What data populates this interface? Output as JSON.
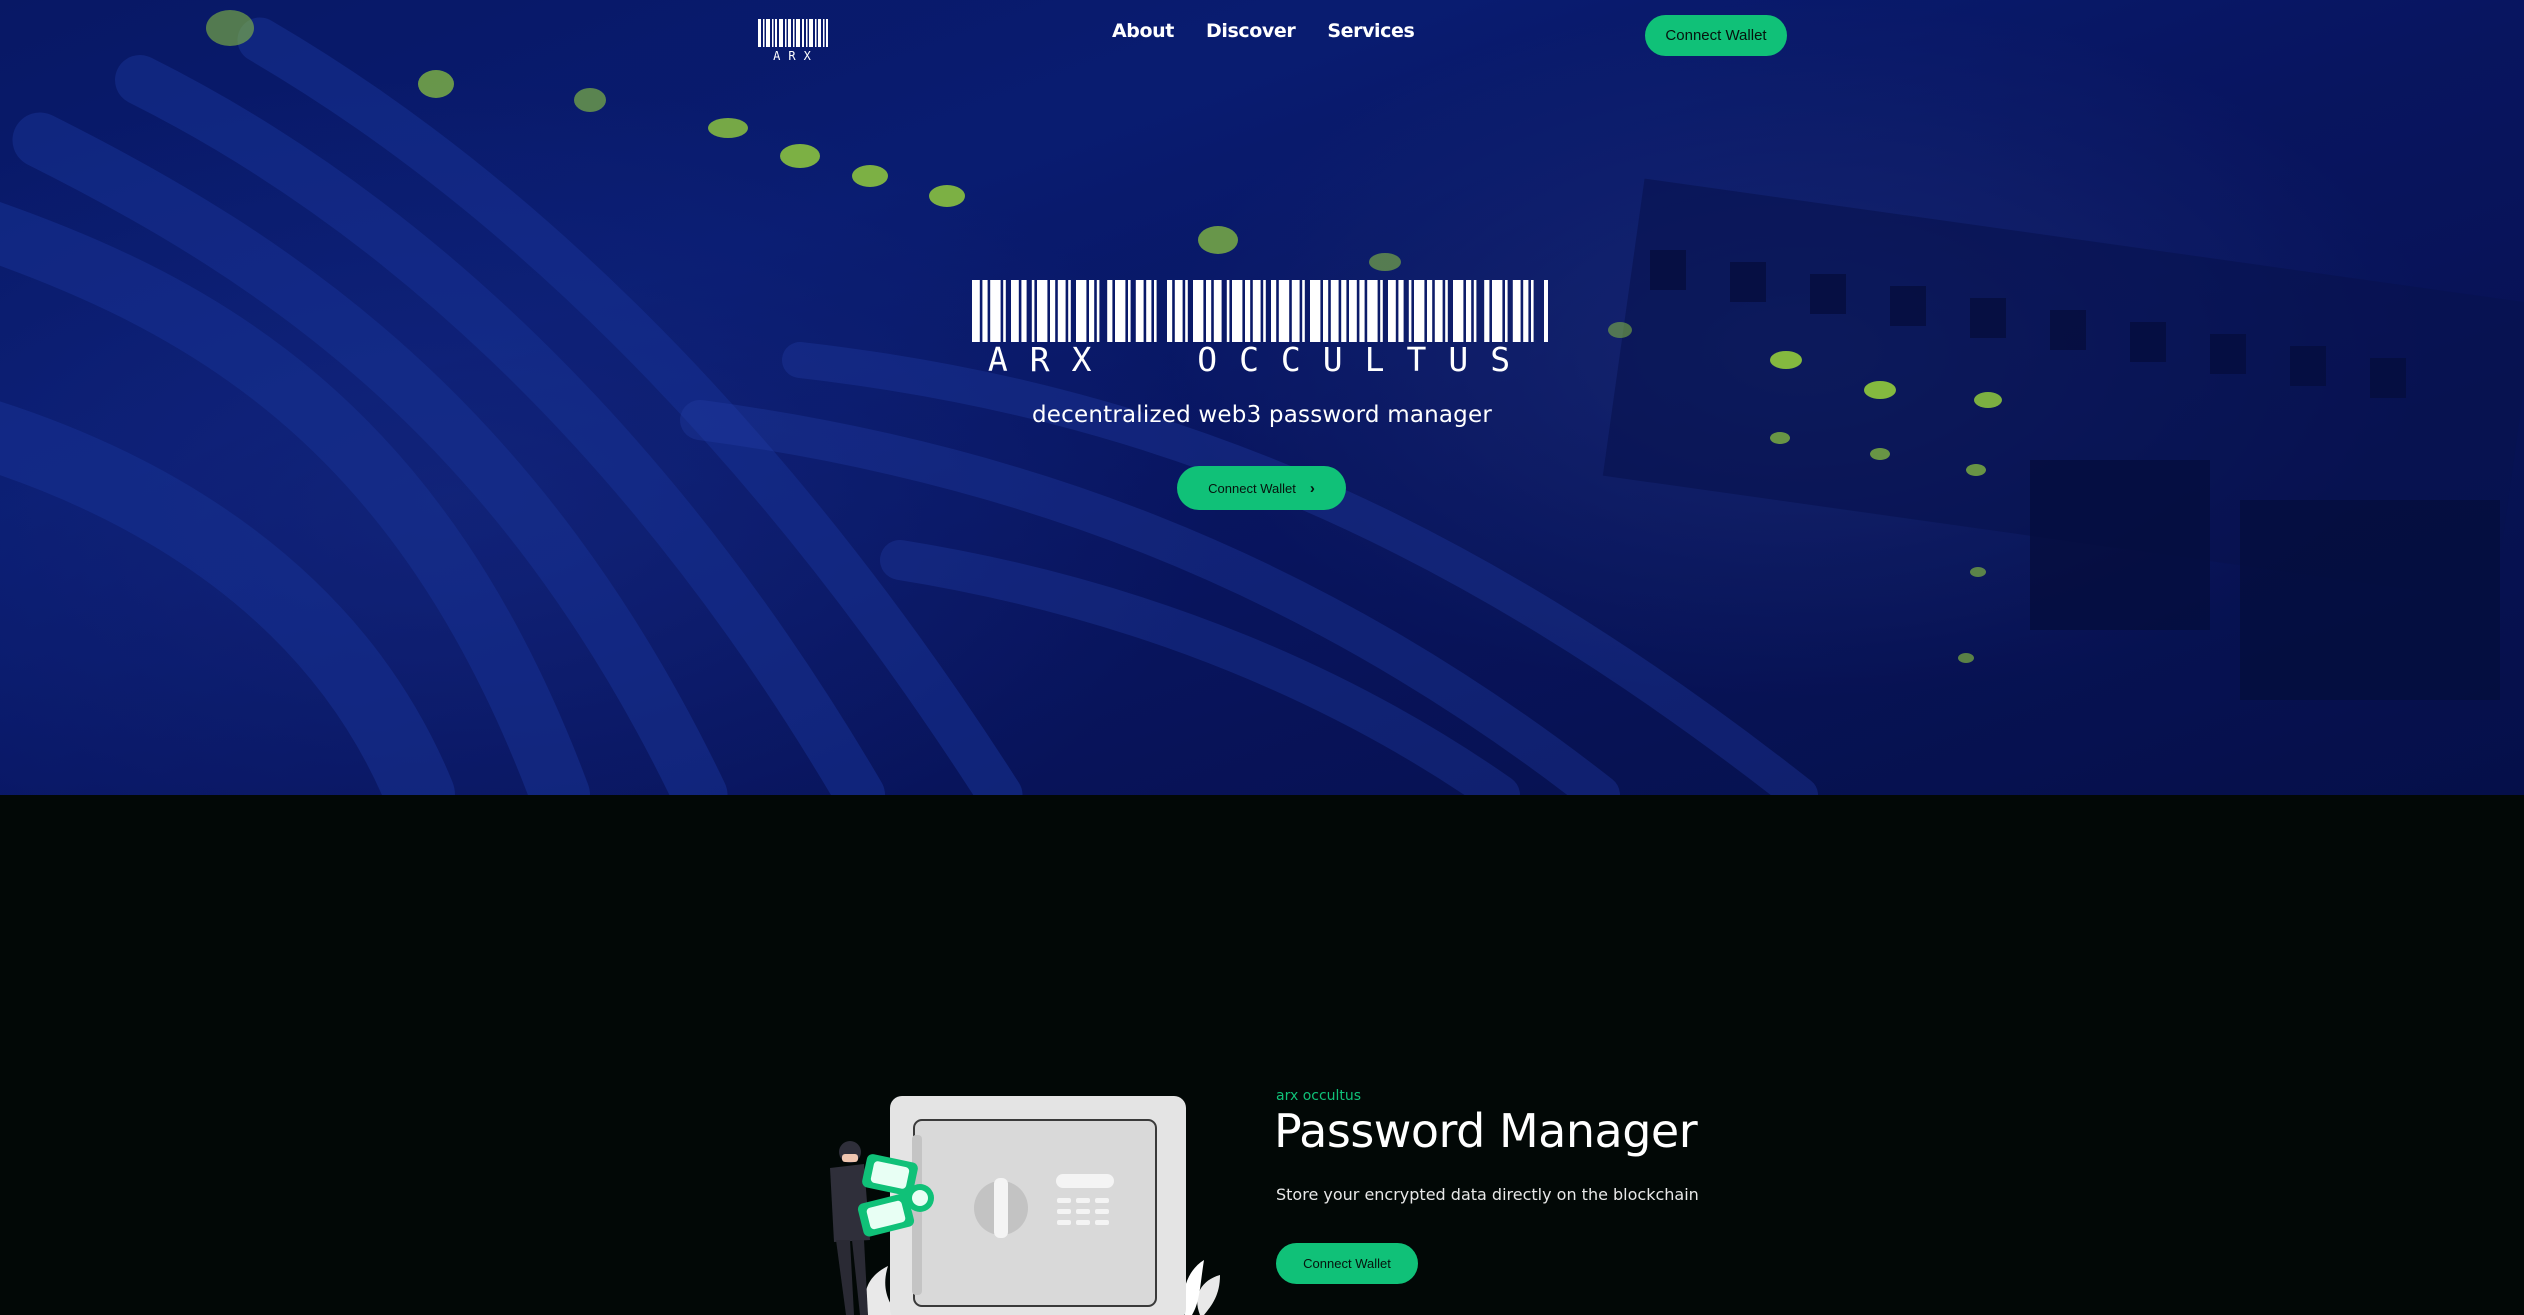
{
  "brand": {
    "logo_text": "ARX",
    "hero_name": "ARX  OCCULTUS",
    "tagline": "decentralized web3 password manager"
  },
  "nav": {
    "links": [
      "About",
      "Discover",
      "Services"
    ],
    "connect_label": "Connect Wallet"
  },
  "hero": {
    "connect_label": "Connect Wallet",
    "chevron": "›"
  },
  "feature": {
    "eyebrow": "arx occultus",
    "title": "Password Manager",
    "description": "Store your encrypted data directly on the blockchain",
    "connect_label": "Connect Wallet"
  },
  "colors": {
    "accent": "#10c178",
    "hero_blue": "#0b1f7c",
    "section_bg": "#020806"
  },
  "icons": {
    "logo": "barcode-logo-icon",
    "hero_logo": "barcode-icon",
    "button_chevron": "chevron-right-icon",
    "illustration": "vault-safe-illustration"
  }
}
